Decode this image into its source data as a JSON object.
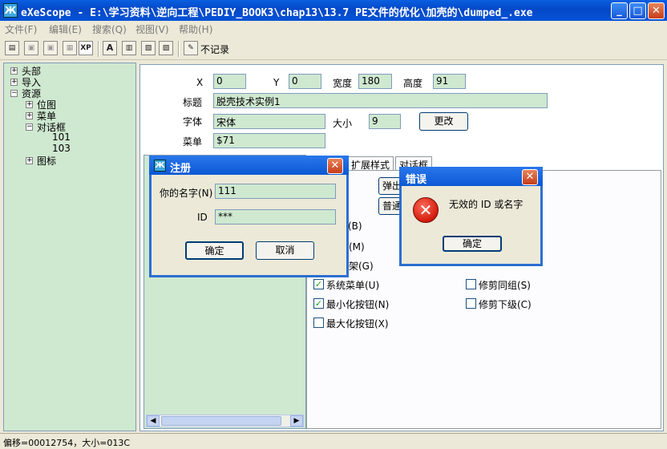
{
  "window": {
    "title": "eXeScope - E:\\学习资料\\逆向工程\\PEDIY_BOOK3\\chap13\\13.7 PE文件的优化\\加壳的\\dumped_.exe",
    "app_icon": "Ж"
  },
  "menu": [
    "文件(F)",
    "编辑(E)",
    "搜索(Q)",
    "视图(V)",
    "帮助(H)"
  ],
  "toolbar": {
    "no_record_label": "不记录",
    "xp_label": "XP"
  },
  "tree": {
    "header": "头部",
    "import": "导入",
    "resource": "资源",
    "bitmap": "位图",
    "menu": "菜单",
    "dialog": "对话框",
    "d101": "101",
    "d103": "103",
    "icon": "图标"
  },
  "props": {
    "x_label": "X",
    "x_value": "0",
    "y_label": "Y",
    "y_value": "0",
    "width_label": "宽度",
    "width_value": "180",
    "height_label": "高度",
    "height_value": "91",
    "caption_label": "标题",
    "caption_value": "脱壳技术实例1",
    "font_label": "字体",
    "font_value": "宋体",
    "size_label": "大小",
    "size_value": "9",
    "change_button": "更改",
    "menu_label": "菜单",
    "menu_value": "$71"
  },
  "tabs": {
    "extended": "扩展样式",
    "dialog": "对话框"
  },
  "style_buttons": {
    "popup": "弹出",
    "normal": "普通"
  },
  "checkboxes": [
    {
      "label": "(B)",
      "checked": false
    },
    {
      "label": "框(M)",
      "checked": false
    },
    {
      "label": "框架(G)",
      "checked": false
    },
    {
      "label": "系统菜单(U)",
      "checked": true
    },
    {
      "label": "最小化按钮(N)",
      "checked": true
    },
    {
      "label": "最大化按钮(X)",
      "checked": false
    },
    {
      "label": "修剪同组(S)",
      "checked": false
    },
    {
      "label": "修剪下级(C)",
      "checked": false
    }
  ],
  "register_dialog": {
    "title": "注册",
    "name_label": "你的名字(N)",
    "name_value": "111",
    "id_label": "ID",
    "id_value": "***",
    "ok_button": "确定",
    "cancel_button": "取消"
  },
  "error_dialog": {
    "title": "错误",
    "message": "无效的 ID 或名字",
    "ok_button": "确定"
  },
  "status": {
    "text": "偏移=00012754，大小=013C"
  }
}
